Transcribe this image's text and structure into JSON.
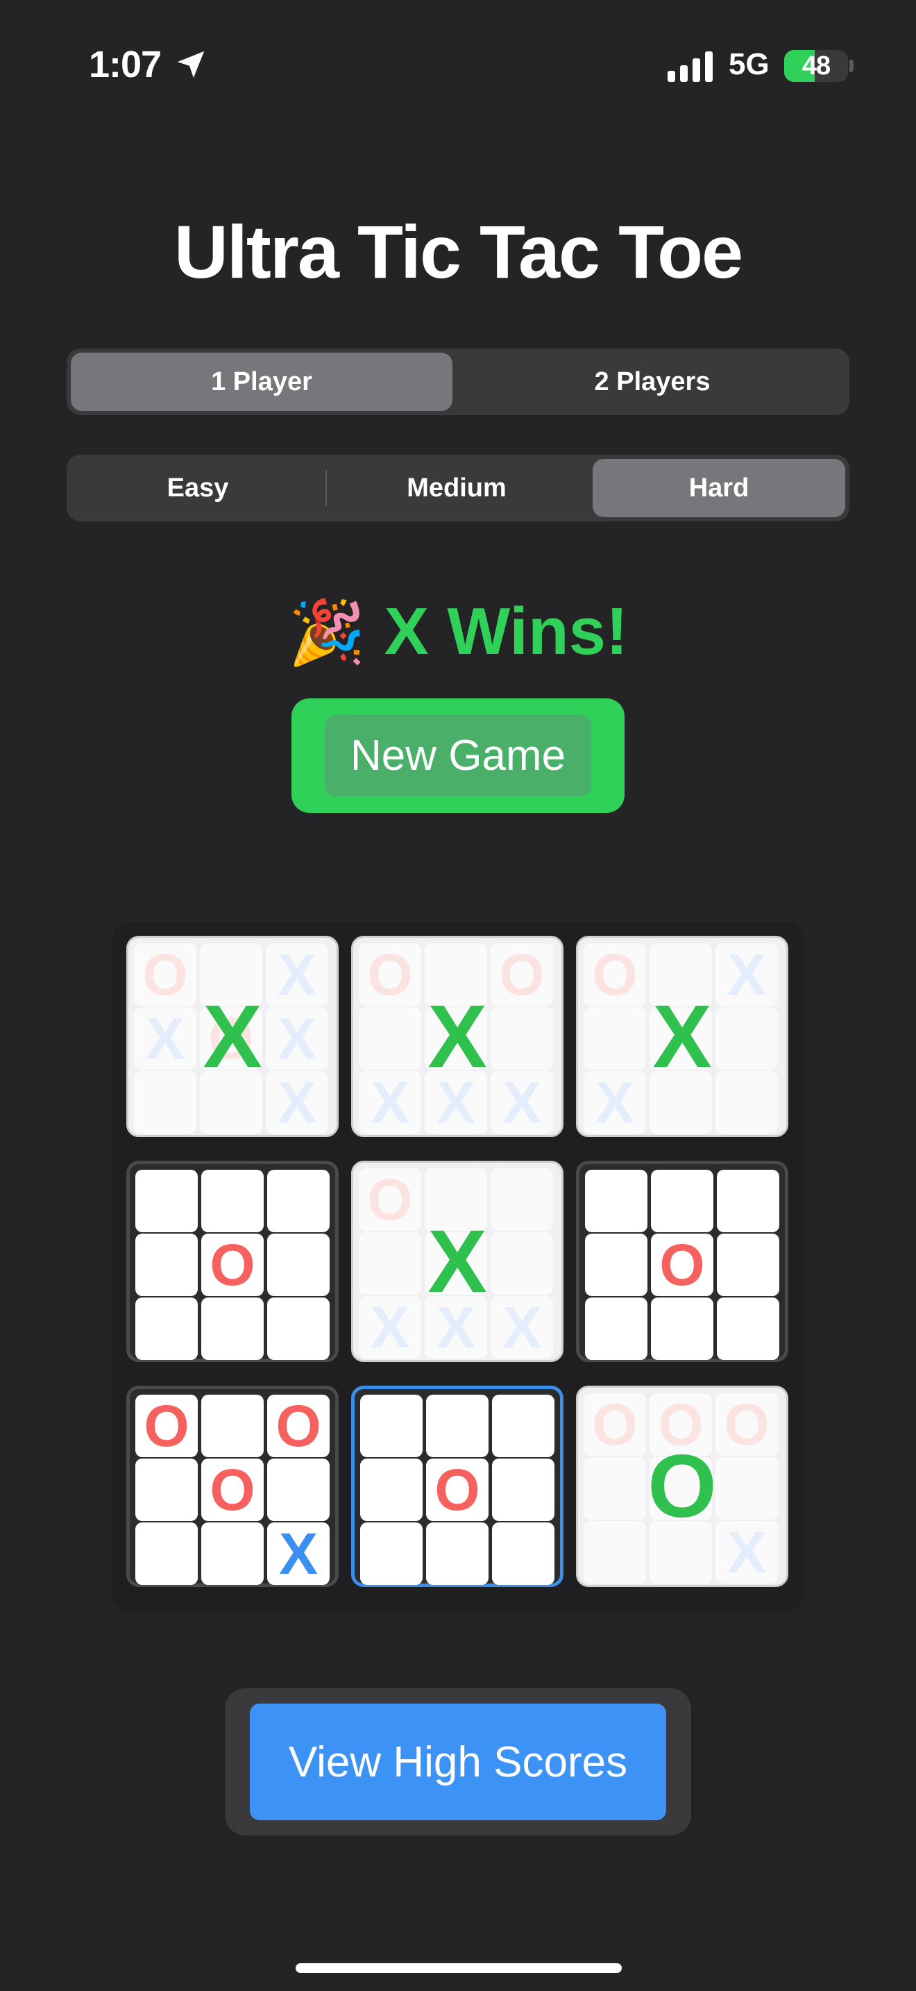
{
  "status_bar": {
    "time": "1:07",
    "network": "5G",
    "battery": "48",
    "battery_level": 0.48
  },
  "title": "Ultra Tic Tac Toe",
  "mode_selector": {
    "options": [
      "1 Player",
      "2 Players"
    ],
    "selected": "1 Player"
  },
  "difficulty_selector": {
    "options": [
      "Easy",
      "Medium",
      "Hard"
    ],
    "selected": "Hard"
  },
  "result": {
    "emoji": "🎉",
    "text": "X Wins!"
  },
  "new_game_label": "New Game",
  "high_scores_label": "View High Scores",
  "colors": {
    "background": "#242426",
    "green": "#30d158",
    "blue": "#3d93f5",
    "o_red": "#f4615e",
    "x_blue": "#3a8ff0"
  },
  "board": [
    {
      "state": "played",
      "winner": "X",
      "cells": [
        "O",
        "",
        "X",
        "X",
        "O",
        "X",
        "",
        "",
        "X"
      ]
    },
    {
      "state": "played",
      "winner": "X",
      "cells": [
        "O",
        "",
        "O",
        "",
        "",
        "",
        "X",
        "X",
        "X"
      ]
    },
    {
      "state": "played",
      "winner": "X",
      "cells": [
        "O",
        "",
        "X",
        "",
        "",
        "",
        "X",
        "",
        ""
      ]
    },
    {
      "state": "open",
      "winner": "",
      "cells": [
        "",
        "",
        "",
        "",
        "O",
        "",
        "",
        "",
        ""
      ]
    },
    {
      "state": "played",
      "winner": "X",
      "cells": [
        "O",
        "",
        "",
        "",
        "",
        "",
        "X",
        "X",
        "X"
      ]
    },
    {
      "state": "open",
      "winner": "",
      "cells": [
        "",
        "",
        "",
        "",
        "O",
        "",
        "",
        "",
        ""
      ]
    },
    {
      "state": "open",
      "winner": "",
      "cells": [
        "O",
        "",
        "O",
        "",
        "O",
        "",
        "",
        "",
        "X"
      ]
    },
    {
      "state": "highlight",
      "winner": "",
      "cells": [
        "",
        "",
        "",
        "",
        "O",
        "",
        "",
        "",
        ""
      ]
    },
    {
      "state": "played",
      "winner": "O",
      "cells": [
        "O",
        "O",
        "O",
        "",
        "",
        "",
        "",
        "",
        "X"
      ]
    }
  ]
}
